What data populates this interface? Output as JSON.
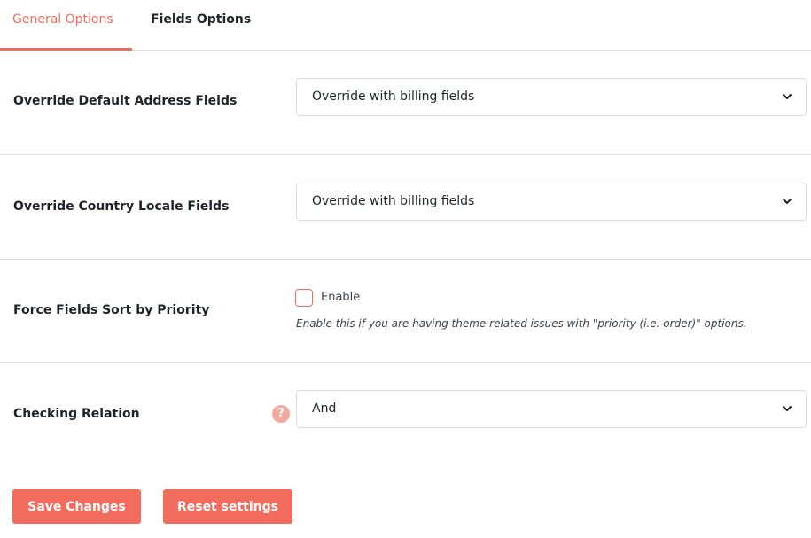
{
  "tabs": {
    "general": "General Options",
    "fields": "Fields Options"
  },
  "rows": [
    {
      "label": "Override Default Address Fields",
      "value": "Override with billing fields"
    },
    {
      "label": "Override Country Locale Fields",
      "value": "Override with billing fields"
    },
    {
      "label": "Force Fields Sort by Priority",
      "checkbox_label": "Enable",
      "checked": false,
      "help": "Enable this if you are having theme related issues with \"priority (i.e. order)\" options."
    },
    {
      "label": "Checking Relation",
      "help_icon": "?",
      "value": "And"
    }
  ],
  "buttons": {
    "save": "Save Changes",
    "reset": "Reset settings"
  },
  "icons": {
    "chevron": "chevron-down-icon",
    "help": "question-circle-icon"
  },
  "colors": {
    "accent": "#f26c5e",
    "help_icon": "#f5a89e",
    "border": "#dcdcde"
  }
}
